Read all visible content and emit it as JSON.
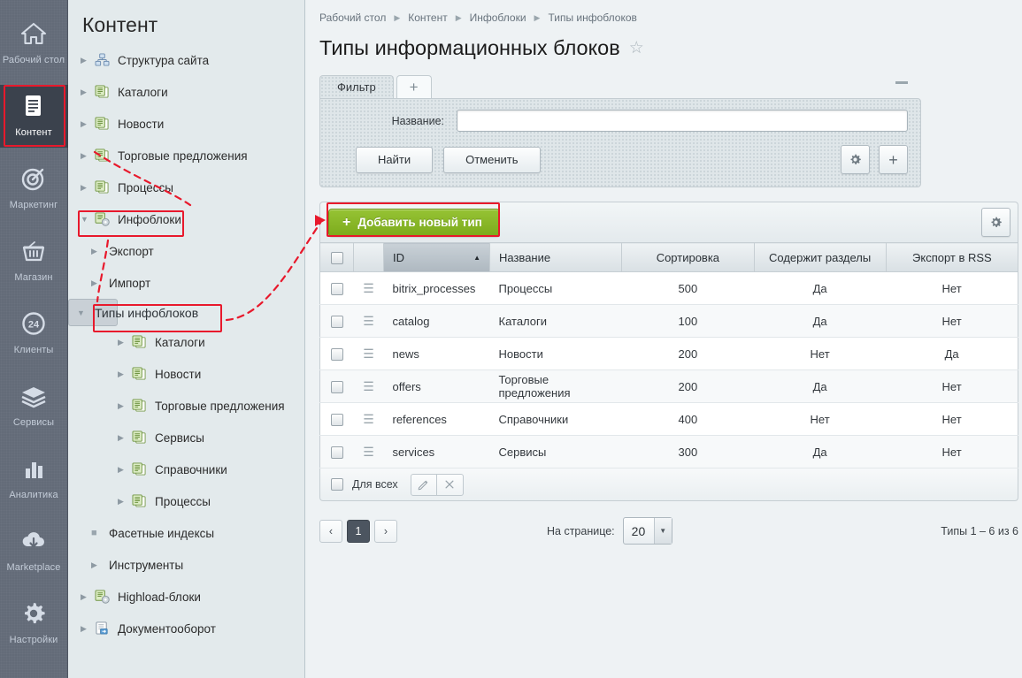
{
  "rail": {
    "items": [
      {
        "label": "Рабочий стол",
        "icon": "home-icon",
        "active": false
      },
      {
        "label": "Контент",
        "icon": "document-icon",
        "active": true
      },
      {
        "label": "Маркетинг",
        "icon": "target-icon",
        "active": false
      },
      {
        "label": "Магазин",
        "icon": "basket-icon",
        "active": false
      },
      {
        "label": "Клиенты",
        "icon": "clients-24-icon",
        "active": false
      },
      {
        "label": "Сервисы",
        "icon": "layers-icon",
        "active": false
      },
      {
        "label": "Аналитика",
        "icon": "bar-chart-icon",
        "active": false
      },
      {
        "label": "Marketplace",
        "icon": "cloud-download-icon",
        "active": false
      },
      {
        "label": "Настройки",
        "icon": "gear-icon",
        "active": false
      }
    ]
  },
  "sidebar": {
    "title": "Контент",
    "items": [
      {
        "label": "Структура сайта",
        "level": 1,
        "arrow": "right",
        "icon": "sitemap-icon",
        "selected": false
      },
      {
        "label": "Каталоги",
        "level": 1,
        "arrow": "right",
        "icon": "iblock-icon",
        "selected": false
      },
      {
        "label": "Новости",
        "level": 1,
        "arrow": "right",
        "icon": "iblock-icon",
        "selected": false
      },
      {
        "label": "Торговые предложения",
        "level": 1,
        "arrow": "right",
        "icon": "iblock-icon",
        "selected": false
      },
      {
        "label": "Процессы",
        "level": 1,
        "arrow": "right",
        "icon": "iblock-icon",
        "selected": false
      },
      {
        "label": "Инфоблоки",
        "level": 1,
        "arrow": "down",
        "icon": "iblock-gear-icon",
        "selected": false
      },
      {
        "label": "Экспорт",
        "level": 2,
        "arrow": "right",
        "icon": "none",
        "selected": false
      },
      {
        "label": "Импорт",
        "level": 2,
        "arrow": "right",
        "icon": "none",
        "selected": false
      },
      {
        "label": "Типы инфоблоков",
        "level": 2,
        "arrow": "down",
        "icon": "none",
        "selected": true
      },
      {
        "label": "Каталоги",
        "level": 3,
        "arrow": "right",
        "icon": "iblock-icon",
        "selected": false
      },
      {
        "label": "Новости",
        "level": 3,
        "arrow": "right",
        "icon": "iblock-icon",
        "selected": false
      },
      {
        "label": "Торговые предложения",
        "level": 3,
        "arrow": "right",
        "icon": "iblock-icon",
        "selected": false
      },
      {
        "label": "Сервисы",
        "level": 3,
        "arrow": "right",
        "icon": "iblock-icon",
        "selected": false
      },
      {
        "label": "Справочники",
        "level": 3,
        "arrow": "right",
        "icon": "iblock-icon",
        "selected": false
      },
      {
        "label": "Процессы",
        "level": 3,
        "arrow": "right",
        "icon": "iblock-icon",
        "selected": false
      },
      {
        "label": "Фасетные индексы",
        "level": 2,
        "arrow": "dot",
        "icon": "none",
        "selected": false
      },
      {
        "label": "Инструменты",
        "level": 2,
        "arrow": "right",
        "icon": "none",
        "selected": false
      },
      {
        "label": "Highload-блоки",
        "level": 1,
        "arrow": "right",
        "icon": "iblock-gear-icon",
        "selected": false
      },
      {
        "label": "Документооборот",
        "level": 1,
        "arrow": "right",
        "icon": "docflow-icon",
        "selected": false
      }
    ]
  },
  "breadcrumb": [
    "Рабочий стол",
    "Контент",
    "Инфоблоки",
    "Типы инфоблоков"
  ],
  "page": {
    "title": "Типы информационных блоков",
    "favorite_icon": "star-icon"
  },
  "filter": {
    "tab_label": "Фильтр",
    "add_tab_icon": "plus-icon",
    "collapse_icon": "minus-icon",
    "field_label": "Название:",
    "field_value": "",
    "field_placeholder": "",
    "find_label": "Найти",
    "cancel_label": "Отменить",
    "settings_icon": "gear-icon",
    "add_icon": "plus-icon"
  },
  "grid": {
    "add_button_label": "Добавить новый тип",
    "add_button_icon": "plus-icon",
    "add_button_color": "#8cba2a",
    "settings_icon": "gear-icon",
    "select_all_icon": "checkbox-icon",
    "sort_column": "ID",
    "sort_direction": "asc",
    "columns": [
      "ID",
      "Название",
      "Сортировка",
      "Содержит разделы",
      "Экспорт в RSS"
    ],
    "rows": [
      {
        "id": "bitrix_processes",
        "name": "Процессы",
        "sort": "500",
        "sections": "Да",
        "rss": "Нет"
      },
      {
        "id": "catalog",
        "name": "Каталоги",
        "sort": "100",
        "sections": "Да",
        "rss": "Нет"
      },
      {
        "id": "news",
        "name": "Новости",
        "sort": "200",
        "sections": "Нет",
        "rss": "Да"
      },
      {
        "id": "offers",
        "name": "Торговые предложения",
        "sort": "200",
        "sections": "Да",
        "rss": "Нет"
      },
      {
        "id": "references",
        "name": "Справочники",
        "sort": "400",
        "sections": "Нет",
        "rss": "Нет"
      },
      {
        "id": "services",
        "name": "Сервисы",
        "sort": "300",
        "sections": "Да",
        "rss": "Нет"
      }
    ],
    "footer_label": "Для всех",
    "edit_icon": "pencil-icon",
    "delete_icon": "close-icon"
  },
  "pagination": {
    "prev_icon": "chevron-left-icon",
    "next_icon": "chevron-right-icon",
    "current_page": "1",
    "per_page_label": "На странице:",
    "per_page_value": "20",
    "total_label": "Типы 1 – 6 из 6"
  }
}
